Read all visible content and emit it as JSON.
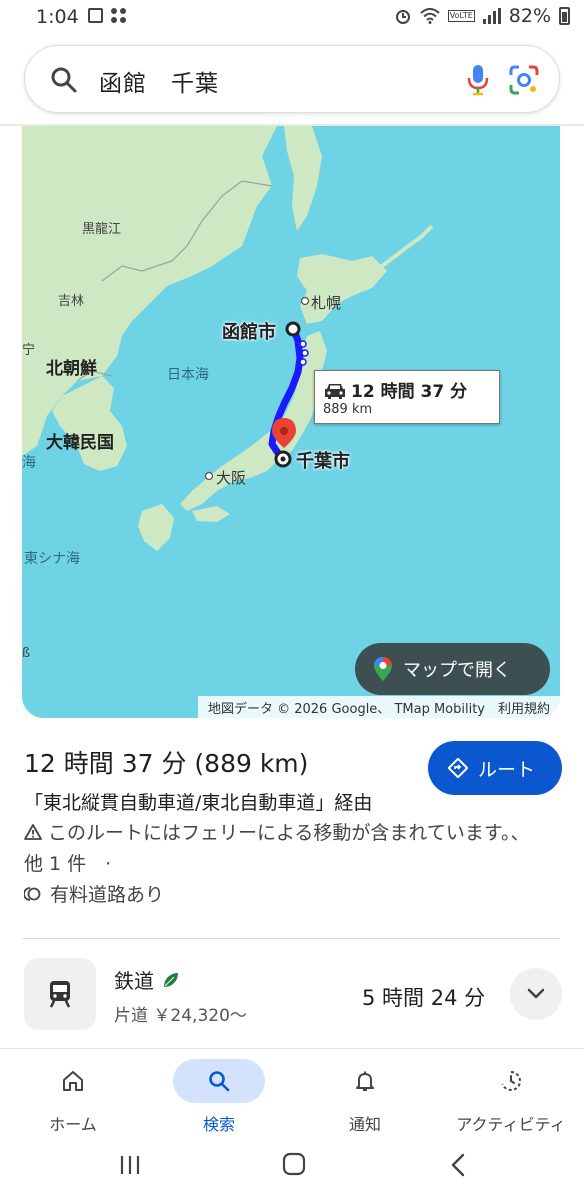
{
  "status_bar": {
    "time": "1:04",
    "battery": "82%",
    "network_badge": "VoLTE"
  },
  "search": {
    "query": "函館　千葉"
  },
  "map": {
    "labels": {
      "heilongjiang": "黒龍江",
      "jilin": "吉林",
      "west_fragment": "宁",
      "north_korea": "北朝鮮",
      "south_korea": "大韓民国",
      "sea_of_japan": "日本海",
      "west_sea_fragment": "海",
      "east_china_sea": "東シナ海",
      "sapporo": "札幌",
      "hakodate": "函館市",
      "chiba": "千葉市",
      "osaka": "大阪",
      "edge_fragment": "ß"
    },
    "route_callout": {
      "time": "12 時間 37 分",
      "distance": "889 km"
    },
    "open_in_maps_label": "マップで開く",
    "attribution": "地図データ © 2026 Google、 TMap Mobility　利用規約",
    "colors": {
      "water": "#6fd3e6",
      "land": "#cfe8c4",
      "route": "#1a1aff",
      "destination_pin": "#ea4335"
    }
  },
  "route": {
    "summary": "12 時間 37 分 (889 km)",
    "button_label": "ルート",
    "via": "「東北縦貫自動車道/東北自動車道」経由",
    "ferry_warning": "このルートにはフェリーによる移動が含まれています。、他 1 件　·",
    "toll_note": "有料道路あり"
  },
  "train": {
    "title": "鉄道",
    "fare": "片道 ￥24,320〜",
    "duration": "5 時間 24 分"
  },
  "bottom_nav": {
    "items": [
      {
        "label": "ホーム",
        "icon": "home-icon"
      },
      {
        "label": "検索",
        "icon": "search-icon",
        "active": true
      },
      {
        "label": "通知",
        "icon": "bell-icon"
      },
      {
        "label": "アクティビティ",
        "icon": "activity-icon"
      }
    ]
  }
}
